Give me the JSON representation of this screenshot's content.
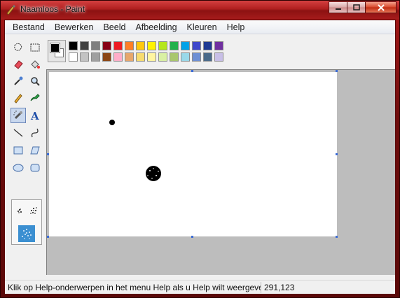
{
  "window": {
    "title": "Naamloos - Paint",
    "buttons": [
      "minimize",
      "maximize",
      "close"
    ]
  },
  "menu": [
    "Bestand",
    "Bewerken",
    "Beeld",
    "Afbeelding",
    "Kleuren",
    "Help"
  ],
  "tools": [
    "free-form-select",
    "select",
    "eraser",
    "fill",
    "pick-color",
    "magnifier",
    "pencil",
    "brush",
    "airbrush",
    "text",
    "line",
    "curve",
    "rectangle",
    "polygon",
    "ellipse",
    "rounded-rectangle"
  ],
  "active_tool": "airbrush",
  "colors": {
    "foreground": "#000000",
    "background": "#ffffff",
    "palette_top": [
      "#000000",
      "#404040",
      "#7f7f7f",
      "#880015",
      "#ed1c24",
      "#ff7f27",
      "#ffc90e",
      "#fff200",
      "#b5e61d",
      "#22b14c",
      "#00a2e8",
      "#3f48cc",
      "#1f3a93",
      "#7030a0"
    ],
    "palette_bottom": [
      "#ffffff",
      "#c3c3c3",
      "#a0a0a0",
      "#8b4513",
      "#ffaec9",
      "#e7a76b",
      "#f7dc6f",
      "#fff5a0",
      "#d9f0a3",
      "#a9c76d",
      "#99d9ea",
      "#6d8fd4",
      "#4a6a8a",
      "#c8bfe7"
    ]
  },
  "status": {
    "help_text": "Klik op Help-onderwerpen in het menu Help als u Help wilt weergeve",
    "coords": "291,123"
  }
}
